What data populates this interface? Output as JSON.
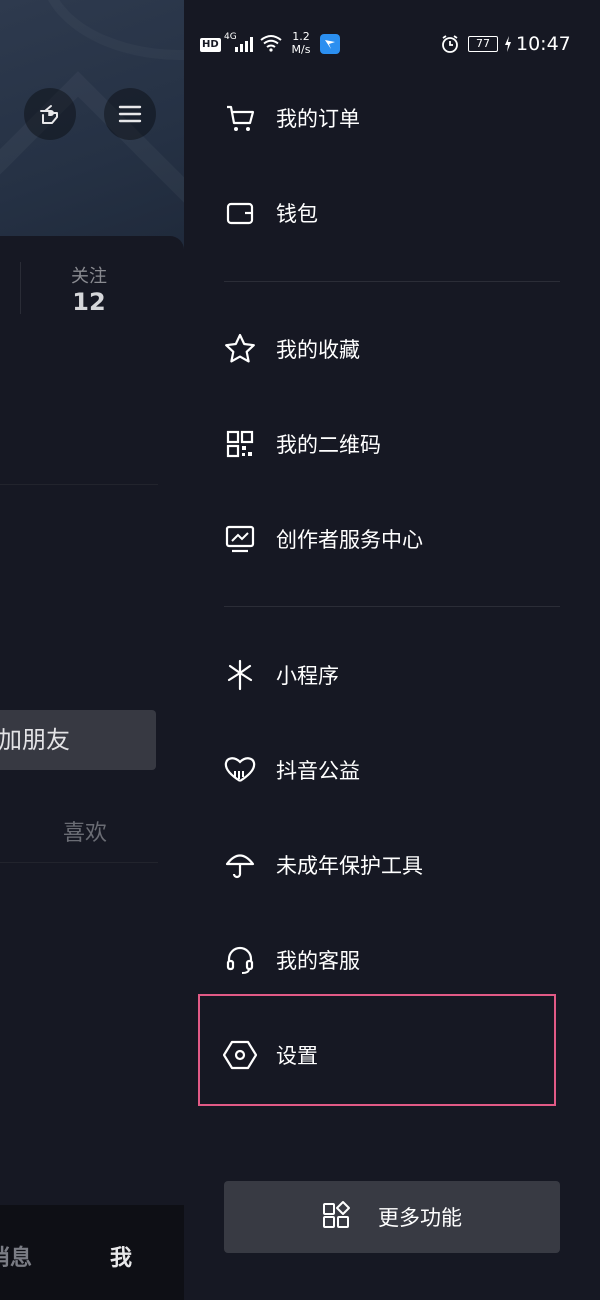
{
  "status_bar": {
    "hd_badge": "HD",
    "network": "4G",
    "net_speed_value": "1.2",
    "net_speed_unit": "M/s",
    "battery": "77",
    "time": "10:47"
  },
  "profile": {
    "stat_label": "关注",
    "stat_value": "12",
    "add_friend_label": "加朋友",
    "like_tab_label": "喜欢"
  },
  "bottom_nav": {
    "messages_label": "消息",
    "me_label": "我"
  },
  "drawer": {
    "items": [
      {
        "label": "我的订单",
        "icon": "cart-icon"
      },
      {
        "label": "钱包",
        "icon": "wallet-icon"
      },
      {
        "label": "我的收藏",
        "icon": "star-icon"
      },
      {
        "label": "我的二维码",
        "icon": "qrcode-icon"
      },
      {
        "label": "创作者服务中心",
        "icon": "creator-monitor-icon"
      },
      {
        "label": "小程序",
        "icon": "mini-program-icon"
      },
      {
        "label": "抖音公益",
        "icon": "charity-heart-icon"
      },
      {
        "label": "未成年保护工具",
        "icon": "umbrella-icon"
      },
      {
        "label": "我的客服",
        "icon": "headset-icon"
      },
      {
        "label": "设置",
        "icon": "settings-hexagon-icon"
      }
    ],
    "more_button_label": "更多功能",
    "highlight_color": "#e25a86"
  }
}
